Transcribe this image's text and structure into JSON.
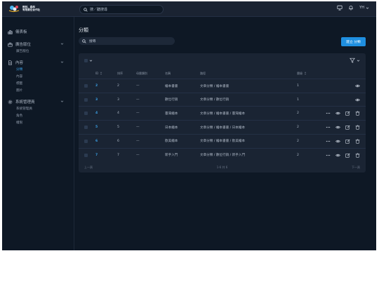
{
  "logo": {
    "line1": "雨林．森林",
    "line2": "有限責任合作社"
  },
  "topbar": {
    "search_placeholder": "搜／聽搜尋",
    "user_initials": "YH",
    "icons": [
      "search-icon",
      "monitor-icon",
      "bell-icon",
      "chevron-down-icon"
    ]
  },
  "sidebar": {
    "groups": [
      {
        "label": "儀表板",
        "icon": "chart-icon",
        "has_children": false
      },
      {
        "label": "廣告版位",
        "icon": "briefcase-icon",
        "has_children": true,
        "children": [
          {
            "label": "廣告版位",
            "active": false
          }
        ]
      },
      {
        "label": "內容",
        "icon": "document-icon",
        "has_children": true,
        "children": [
          {
            "label": "分類",
            "active": true
          },
          {
            "label": "內容",
            "active": false
          },
          {
            "label": "標籤",
            "active": false
          },
          {
            "label": "圖片",
            "active": false
          }
        ]
      },
      {
        "label": "系統管理員",
        "icon": "gear-icon",
        "has_children": true,
        "children": [
          {
            "label": "系統管理員",
            "active": false
          },
          {
            "label": "角色",
            "active": false
          },
          {
            "label": "權限",
            "active": false
          }
        ]
      }
    ]
  },
  "main": {
    "title": "分類",
    "search_placeholder": "搜尋",
    "create_button": "建立 分類"
  },
  "table": {
    "columns": [
      "ID",
      "排序",
      "母層類別",
      "名稱",
      "路徑",
      "層級"
    ],
    "rows": [
      {
        "id": "2",
        "sort": "2",
        "parent": "—",
        "name": "繪本書書",
        "path": "文章分類 / 繪本書書",
        "level": "1",
        "more": false,
        "edit": false,
        "delete": false
      },
      {
        "id": "3",
        "sort": "3",
        "parent": "—",
        "name": "數位行銷",
        "path": "文章分類 / 數位行銷",
        "level": "1",
        "more": false,
        "edit": false,
        "delete": false
      },
      {
        "id": "4",
        "sort": "4",
        "parent": "—",
        "name": "臺灣繪本",
        "path": "文章分類 / 繪本書書 / 臺灣繪本",
        "level": "2",
        "more": true,
        "edit": true,
        "delete": true
      },
      {
        "id": "5",
        "sort": "5",
        "parent": "—",
        "name": "日本繪本",
        "path": "文章分類 / 繪本書書 / 日本繪本",
        "level": "2",
        "more": true,
        "edit": true,
        "delete": true
      },
      {
        "id": "6",
        "sort": "6",
        "parent": "—",
        "name": "歐美繪本",
        "path": "文章分類 / 繪本書書 / 歐美繪本",
        "level": "2",
        "more": true,
        "edit": true,
        "delete": true
      },
      {
        "id": "7",
        "sort": "7",
        "parent": "—",
        "name": "新手入門",
        "path": "文章分類 / 數位行銷 / 新手入門",
        "level": "2",
        "more": true,
        "edit": true,
        "delete": true
      }
    ]
  },
  "pagination": {
    "prev": "上一頁",
    "info": "1-6 共 6",
    "next": "下一頁"
  },
  "colors": {
    "accent": "#1f8fe0",
    "background": "#0e1825",
    "topbar": "#1a2332",
    "panel": "#1a2433"
  }
}
